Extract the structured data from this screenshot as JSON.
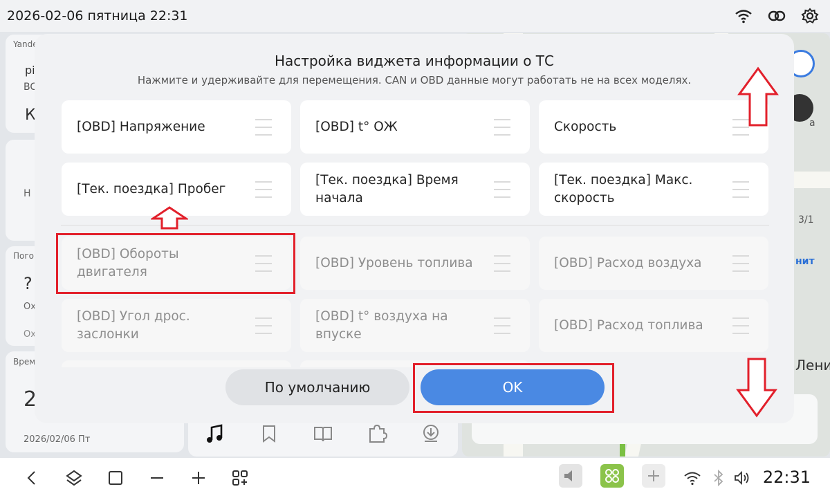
{
  "status_bar": {
    "datetime": "2026-02-06 пятница 22:31",
    "icons": [
      "wifi-icon",
      "link-icon",
      "settings-gear-icon"
    ]
  },
  "background": {
    "card1_title": "Yande",
    "card1_line1": "pi",
    "card1_line2": "BC",
    "card1_big": "К",
    "card2_text": "Н",
    "card3_title": "Пого",
    "card3_big": "?",
    "card3_line1": "Ох",
    "card3_line2": "Ох",
    "card4_title": "Врем",
    "card4_big": "2",
    "card4_date": "2026/02/06 Пт",
    "map_label1": "а",
    "map_label2": "3/1",
    "map_label3": "нит",
    "map_label4": "Лени"
  },
  "dialog": {
    "title": "Настройка виджета информации о ТС",
    "subtitle": "Нажмите и удерживайте для перемещения. CAN и OBD данные могут работать не на всех моделях.",
    "active_tiles": [
      "[OBD] Напряжение",
      "[OBD] t° ОЖ",
      "Скорость",
      "[Тек. поездка] Пробег",
      "[Тек. поездка] Время начала",
      "[Тек. поездка] Макс. скорость"
    ],
    "inactive_tiles": [
      "[OBD] Обороты двигателя",
      "[OBD] Уровень топлива",
      "[OBD] Расход воздуха",
      "[OBD] Угол дрос. заслонки",
      "[OBD] t° воздуха на впуске",
      "[OBD] Расход топлива"
    ],
    "default_button": "По умолчанию",
    "ok_button": "OK"
  },
  "nav_bar": {
    "time": "22:31",
    "icons": [
      "back-icon",
      "home-icon",
      "recents-icon",
      "minus-icon",
      "plus-icon",
      "apps-add-icon",
      "volume-muted-icon",
      "split-screen-icon",
      "add-icon",
      "wifi-icon",
      "bluetooth-icon",
      "volume-icon"
    ]
  },
  "colors": {
    "accent": "#4a89e3",
    "annotation": "#e2202b"
  }
}
